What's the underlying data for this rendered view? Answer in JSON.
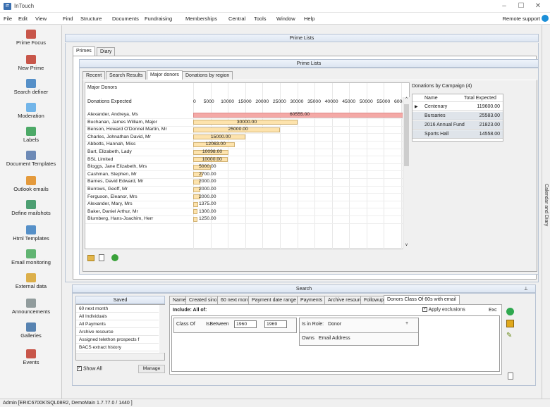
{
  "app": {
    "title": "InTouch",
    "icon_text": "IT"
  },
  "window_controls": {
    "minimize": "–",
    "maximize": "☐",
    "close": "✕"
  },
  "menu": {
    "items": [
      "File",
      "Edit",
      "View",
      "Find",
      "Structure",
      "Documents",
      "Fundraising",
      "Memberships",
      "Central",
      "Tools",
      "Window",
      "Help"
    ],
    "remote_support": "Remote support"
  },
  "sidebar": {
    "items": [
      {
        "label": "Prime Focus",
        "icon": "prime-focus-icon"
      },
      {
        "label": "New Prime",
        "icon": "new-prime-icon"
      },
      {
        "label": "Search definer",
        "icon": "search-definer-icon"
      },
      {
        "label": "Moderation",
        "icon": "moderation-icon"
      },
      {
        "label": "Labels",
        "icon": "labels-icon"
      },
      {
        "label": "Document Templates",
        "icon": "document-templates-icon"
      },
      {
        "label": "Outlook emails",
        "icon": "outlook-emails-icon"
      },
      {
        "label": "Define mailshots",
        "icon": "define-mailshots-icon"
      },
      {
        "label": "Html Templates",
        "icon": "html-templates-icon"
      },
      {
        "label": "Email monitoring",
        "icon": "email-monitoring-icon"
      },
      {
        "label": "External data",
        "icon": "external-data-icon"
      },
      {
        "label": "Announcements",
        "icon": "announcements-icon"
      },
      {
        "label": "Galleries",
        "icon": "galleries-icon"
      },
      {
        "label": "Events",
        "icon": "events-icon"
      }
    ]
  },
  "right_strip": {
    "label": "Calendar and Diary"
  },
  "prime_lists": {
    "header": "Prime Lists",
    "tabs": [
      "Primes",
      "Diary"
    ],
    "inner_header": "Prime Lists",
    "subtabs": [
      "Recent",
      "Search Results",
      "Major donors",
      "Donations by region"
    ],
    "active_subtab": "Major donors"
  },
  "major_donors": {
    "title": "Major Donors",
    "series_label": "Donations Expected"
  },
  "chart_data": {
    "type": "bar",
    "orientation": "horizontal",
    "title": "Major Donors",
    "xlabel": "Donations Expected",
    "xlim": [
      0,
      60000
    ],
    "x_ticks": [
      "0",
      "5000",
      "10000",
      "15000",
      "20000",
      "25000",
      "30000",
      "35000",
      "40000",
      "45000",
      "50000",
      "55000",
      "600("
    ],
    "categories": [
      "Alexander, Andreya, Ms",
      "Buchanan, James William, Major",
      "Benson, Howard O'Donnel Martin, Mr",
      "Charles, Johnathan David, Mr",
      "Abbotts, Hannah, Miss",
      "Bart, Elizabeth, Lady",
      "BSL Limited",
      "Bloggs, Jane Elizabeth, Mrs",
      "Cashman, Stephen, Mr",
      "Barnes, David Edward, Mr",
      "Burrows, Geoff, Mr",
      "Ferguson, Eleanor, Mrs",
      "Alexander, Mary, Mrs",
      "Baker, Daniel Arthur, Mr",
      "Blumberg, Hans-Joachim, Herr"
    ],
    "values": [
      60555,
      30000,
      25000,
      15000,
      12063,
      10098,
      10000,
      5000,
      2700,
      2000,
      2000,
      2000,
      1375,
      1300,
      1250
    ],
    "labels": [
      "60555.00",
      "30000.00",
      "25000.00",
      "15000.00",
      "12063.00",
      "10098.00",
      "10000.00",
      "5000.00",
      "2700.00",
      "2000.00",
      "2000.00",
      "2000.00",
      "1375.00",
      "1300.00",
      "1250.00"
    ],
    "highlight_color": "#f4a9a6",
    "bar_color": "#fde3ad"
  },
  "campaigns": {
    "title": "Donations by Campaign",
    "count": "(4)",
    "headers": [
      "Name",
      "Total Expected"
    ],
    "rows": [
      {
        "name": "Centenary",
        "total": "119600.00"
      },
      {
        "name": "Bursaries",
        "total": "25583.00"
      },
      {
        "name": "2016 Annual Fund",
        "total": "21823.00"
      },
      {
        "name": "Sports Hall",
        "total": "14558.00"
      }
    ]
  },
  "search": {
    "header": "Search",
    "saved_title": "Saved",
    "saved_items": [
      "60 next month",
      "All Individuals",
      "All Payments",
      "Archive resource",
      "Assigned telethon prospects f",
      "BACS extract history"
    ],
    "show_all_label": "Show All",
    "manage_label": "Manage",
    "tabs": [
      "Name",
      "Created since",
      "60 next month",
      "Payment date range",
      "Payments",
      "Archive resource",
      "Followup",
      "Donors Class Of 60s with email"
    ],
    "active_tab": "Donors Class Of 60s with email",
    "include_label": "Include: All of:",
    "apply_exclusions": "Apply exclusions",
    "exc_label": "Exc",
    "criteria": {
      "field": "Class Of",
      "operator": "IsBetween",
      "from": "1960",
      "to": "1969",
      "role_label": "Is in Role:",
      "role_value": "Donor",
      "owns_label": "Owns",
      "owns_value": "Email Address"
    }
  },
  "status": {
    "text": "Admin [ERIC6700K\\SQL08R2, DemoMain 1.7.77.0 / 1440 ]"
  }
}
